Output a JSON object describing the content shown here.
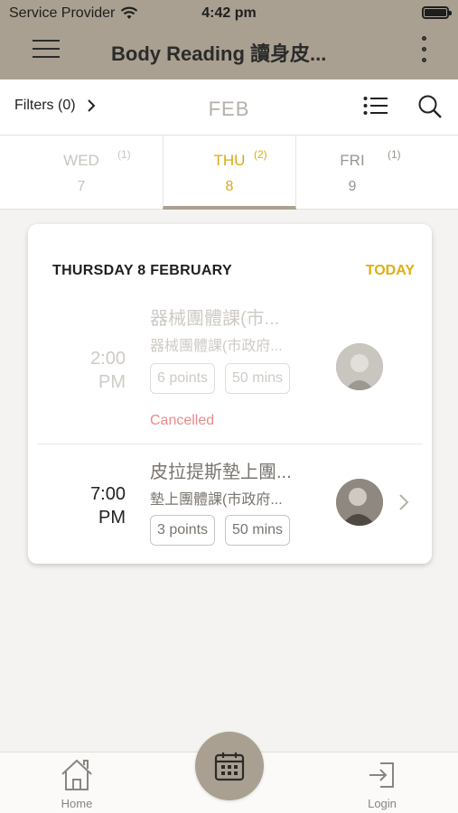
{
  "status_bar": {
    "carrier": "Service Provider",
    "time": "4:42 pm"
  },
  "header": {
    "title": "Body Reading 讀身皮..."
  },
  "filter_bar": {
    "filters_label": "Filters (0)",
    "month": "FEB"
  },
  "days": [
    {
      "name": "WED",
      "date": "7",
      "count": "(1)"
    },
    {
      "name": "THU",
      "date": "8",
      "count": "(2)",
      "selected": true
    },
    {
      "name": "FRI",
      "date": "9",
      "count": "(1)"
    }
  ],
  "card": {
    "heading": "THURSDAY 8 FEBRUARY",
    "today_label": "TODAY",
    "sessions": [
      {
        "time_hm": "2:00",
        "time_ampm": "PM",
        "name": "器械團體課(市...",
        "subtitle": "器械團體課(市政府...",
        "points": "6 points",
        "duration": "50 mins",
        "status": "Cancelled"
      },
      {
        "time_hm": "7:00",
        "time_ampm": "PM",
        "name": "皮拉提斯墊上團...",
        "subtitle": "墊上團體課(市政府...",
        "points": "3 points",
        "duration": "50 mins"
      }
    ]
  },
  "bottom_nav": {
    "home_label": "Home",
    "login_label": "Login"
  },
  "colors": {
    "brand": "#a9a091",
    "accent_gold": "#e0ae12",
    "cancelled_red": "#e78b8b"
  }
}
